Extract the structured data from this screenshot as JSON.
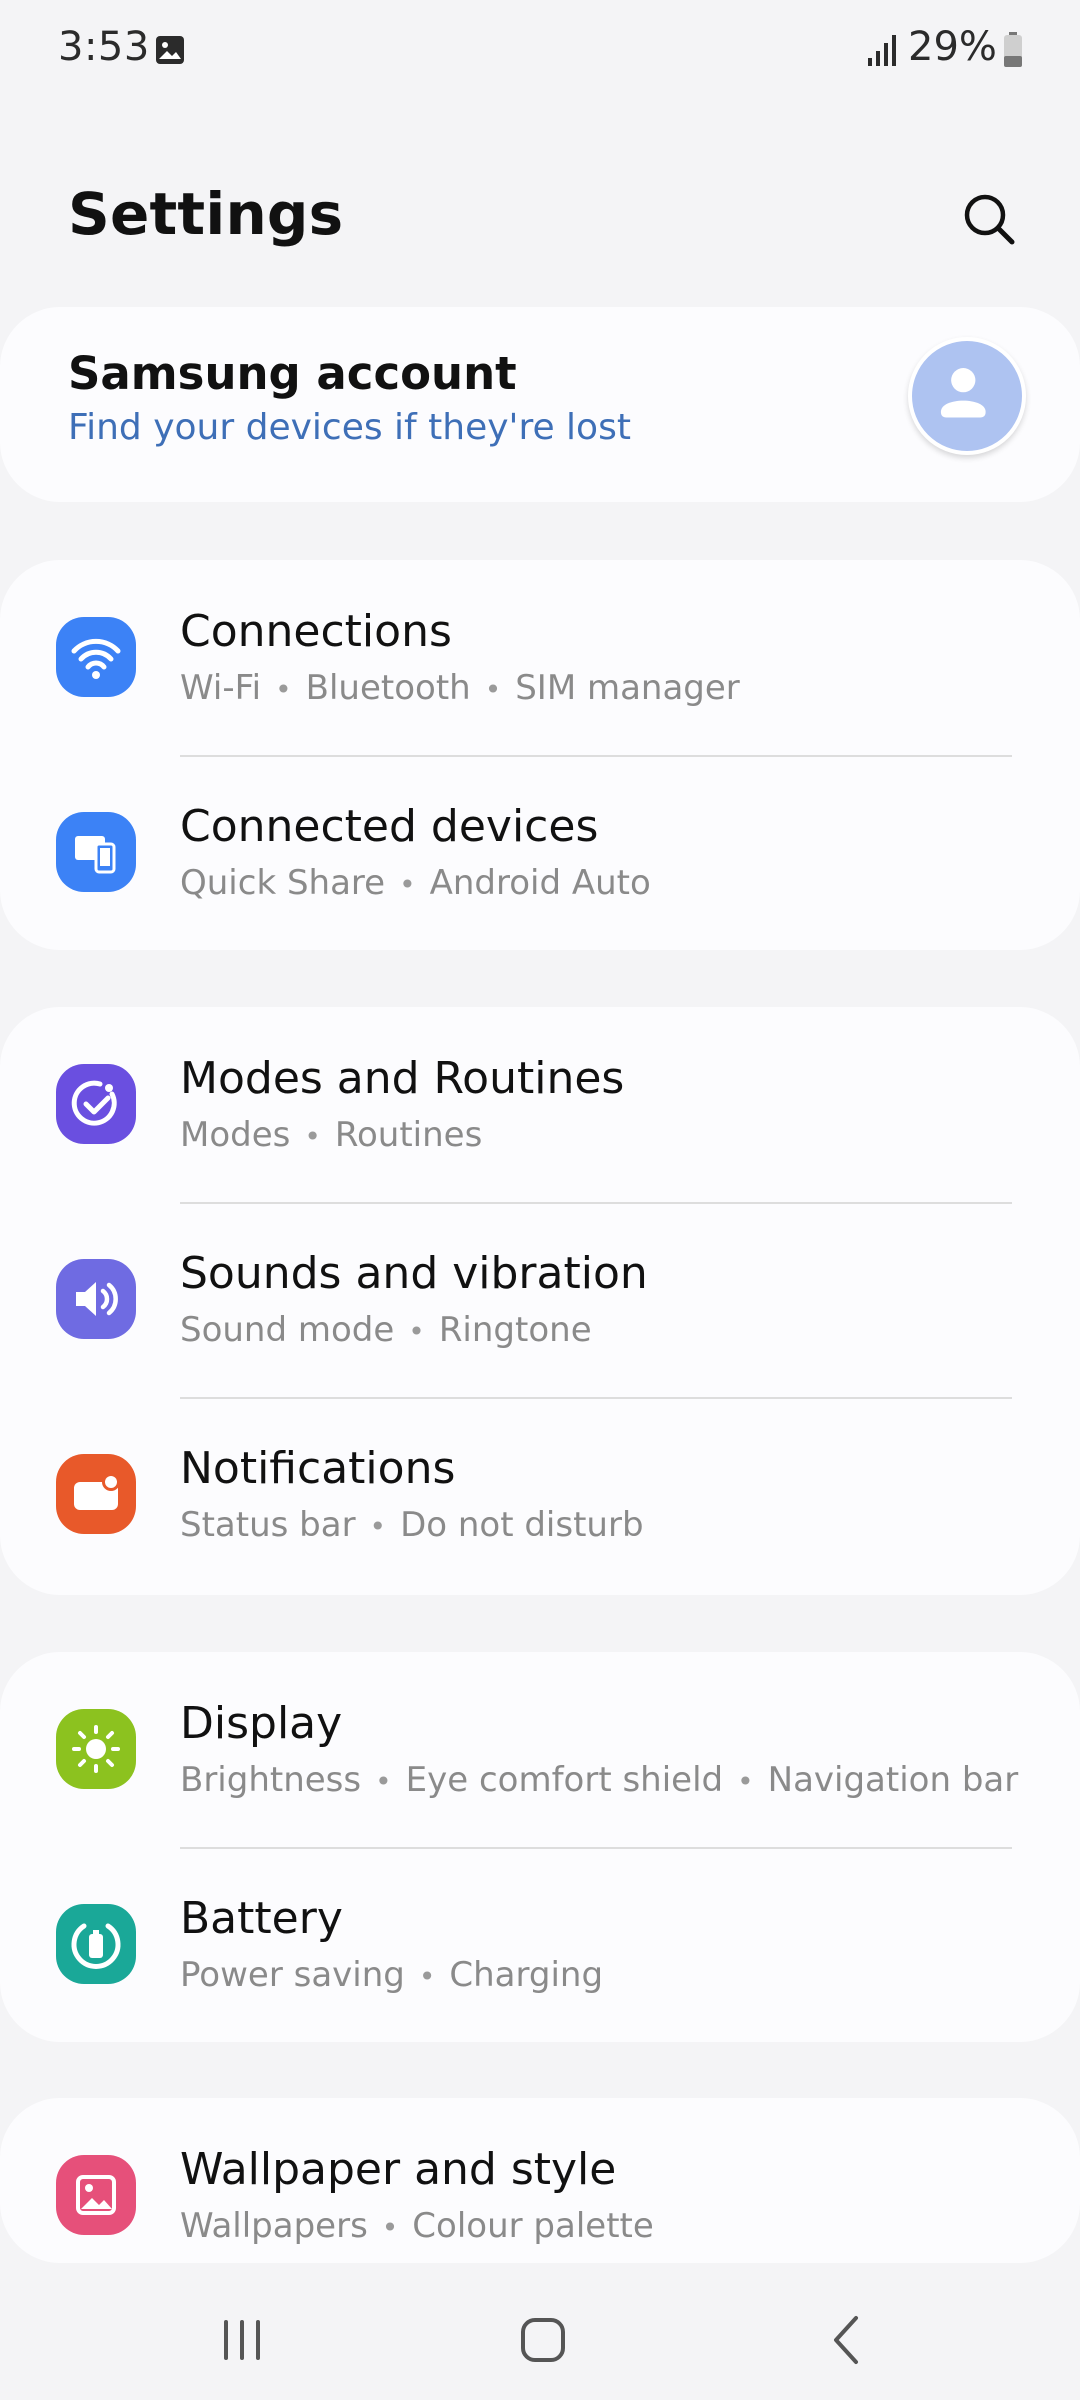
{
  "status_bar": {
    "time": "3:53",
    "battery_percent": "29%"
  },
  "header": {
    "title": "Settings"
  },
  "account": {
    "title": "Samsung account",
    "subtitle": "Find your devices if they're lost"
  },
  "groups": [
    {
      "items": [
        {
          "title": "Connections",
          "subtitle": [
            "Wi-Fi",
            "Bluetooth",
            "SIM manager"
          ],
          "icon": "wifi-icon",
          "color": "#3c82f6"
        },
        {
          "title": "Connected devices",
          "subtitle": [
            "Quick Share",
            "Android Auto"
          ],
          "icon": "connected-devices-icon",
          "color": "#3c82f6"
        }
      ]
    },
    {
      "items": [
        {
          "title": "Modes and Routines",
          "subtitle": [
            "Modes",
            "Routines"
          ],
          "icon": "modes-check-icon",
          "color": "#6a4fe0"
        },
        {
          "title": "Sounds and vibration",
          "subtitle": [
            "Sound mode",
            "Ringtone"
          ],
          "icon": "speaker-icon",
          "color": "#6f6be2"
        },
        {
          "title": "Notifications",
          "subtitle": [
            "Status bar",
            "Do not disturb"
          ],
          "icon": "notification-icon",
          "color": "#e8592a"
        }
      ]
    },
    {
      "items": [
        {
          "title": "Display",
          "subtitle": [
            "Brightness",
            "Eye comfort shield",
            "Navigation bar"
          ],
          "icon": "sun-icon",
          "color": "#8cc21f"
        },
        {
          "title": "Battery",
          "subtitle": [
            "Power saving",
            "Charging"
          ],
          "icon": "battery-icon",
          "color": "#1aa898"
        }
      ]
    },
    {
      "items": [
        {
          "title": "Wallpaper and style",
          "subtitle": [
            "Wallpapers",
            "Colour palette"
          ],
          "icon": "wallpaper-icon",
          "color": "#e6507a"
        }
      ]
    }
  ],
  "colors": {
    "background": "#f4f4f6",
    "card": "#fcfcfe",
    "accent_link": "#3e6fb7",
    "avatar": "#aec3f1"
  }
}
